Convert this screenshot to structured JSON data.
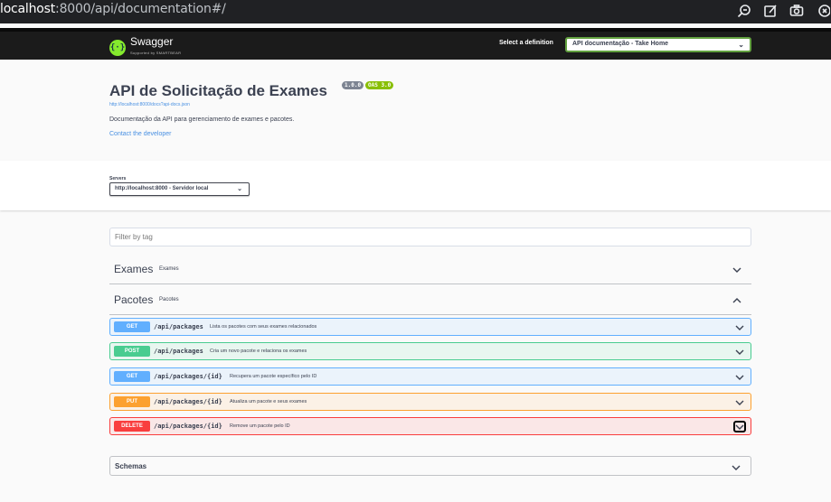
{
  "browser": {
    "url_host": "localhost",
    "url_path": ":8000/api/documentation#/"
  },
  "topbar": {
    "logo_text": "Swagger",
    "logo_sub": "Supported by SMARTBEAR",
    "definition_label": "Select a definition",
    "definition_selected": "API documentação - Take Home"
  },
  "info": {
    "title": "API de Solicitação de Exames",
    "version_badge": "1.0.0",
    "oas_badge": "OAS 3.0",
    "spec_url": "http://localhost:8000/docs?api-docs.json",
    "description": "Documentação da API para gerenciamento de exames e pacotes.",
    "contact": "Contact the developer"
  },
  "servers": {
    "label": "Servers",
    "selected": "http://localhost:8000 - Servidor local"
  },
  "filter": {
    "placeholder": "Filter by tag"
  },
  "tags": [
    {
      "name": "Exames",
      "description": "Exames",
      "expanded": false
    },
    {
      "name": "Pacotes",
      "description": "Pacotes",
      "expanded": true
    }
  ],
  "operations": [
    {
      "method": "GET",
      "path": "/api/packages",
      "summary": "Lista os pacotes com seus exames relacionados"
    },
    {
      "method": "POST",
      "path": "/api/packages",
      "summary": "Cria um novo pacote e relaciona os exames"
    },
    {
      "method": "GET",
      "path": "/api/packages/{id}",
      "summary": "Recupera um pacote específico pelo ID"
    },
    {
      "method": "PUT",
      "path": "/api/packages/{id}",
      "summary": "Atualiza um pacote e seus exames"
    },
    {
      "method": "DELETE",
      "path": "/api/packages/{id}",
      "summary": "Remove um pacote pelo ID"
    }
  ],
  "schemas": {
    "label": "Schemas"
  },
  "colors": {
    "get": "#61affe",
    "post": "#49cc90",
    "put": "#fca130",
    "delete": "#f93e3e",
    "swagger_green": "#85ea2d"
  }
}
